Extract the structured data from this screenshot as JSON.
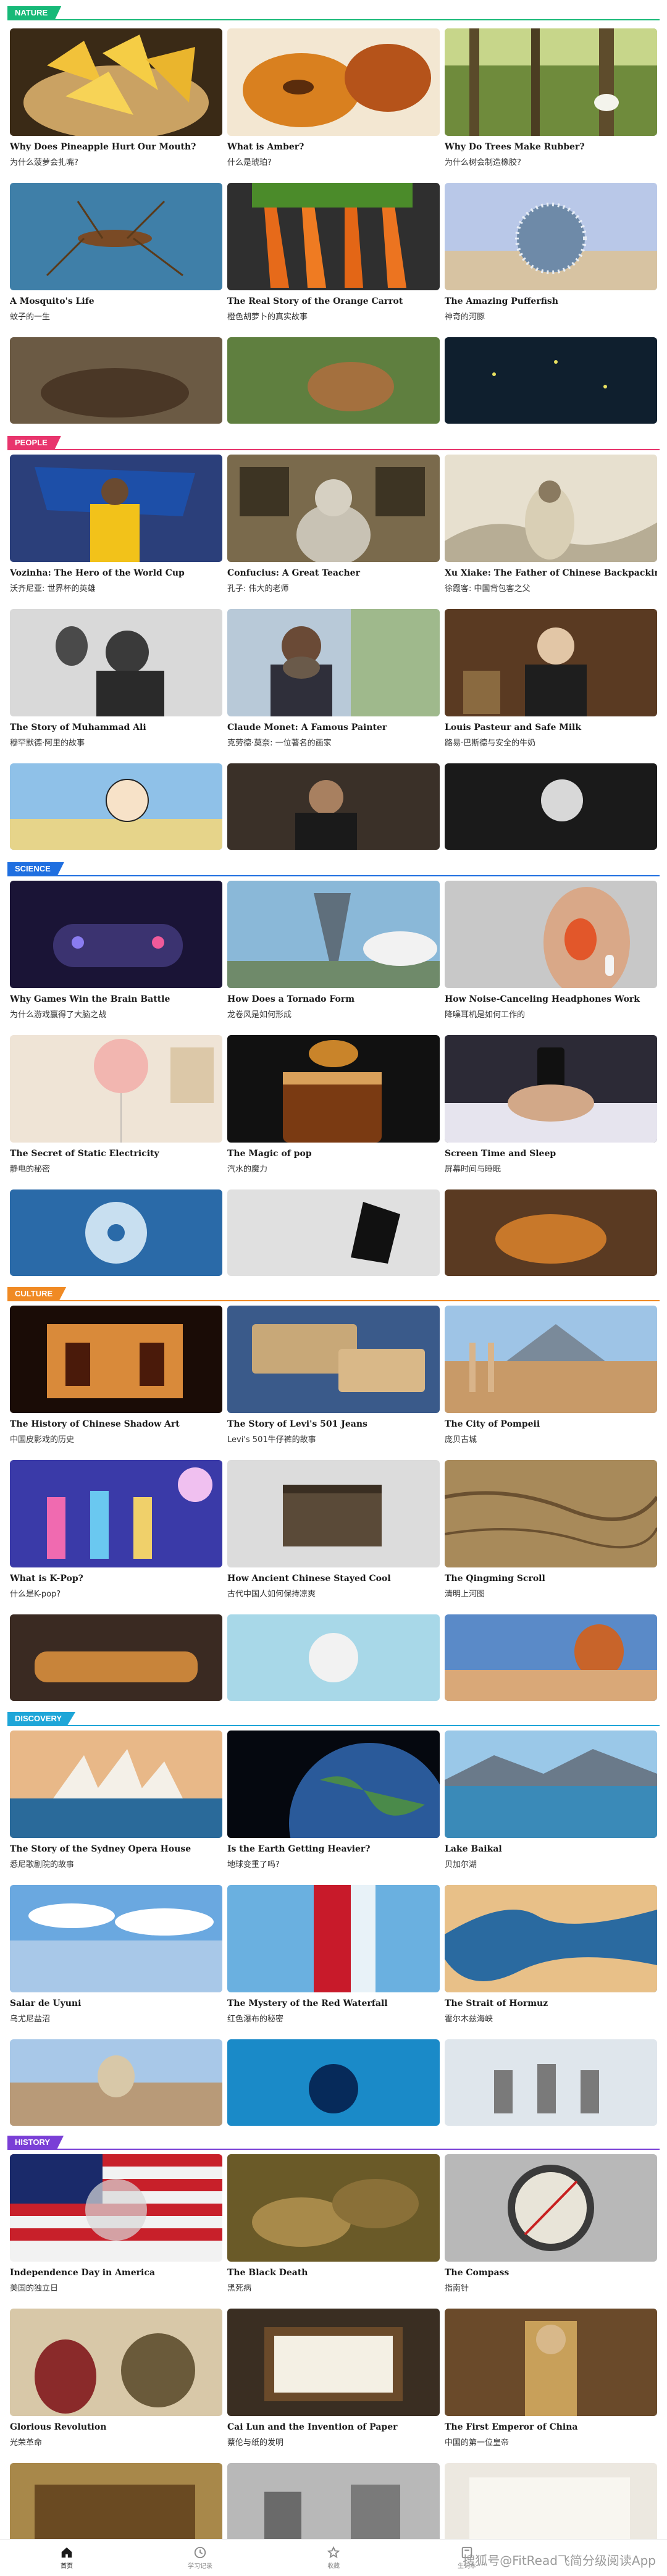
{
  "colors": {
    "nature": "#17b978",
    "people": "#e8356d",
    "science": "#1f6fe0",
    "culture": "#f08a24",
    "discovery": "#1fa6d8",
    "history": "#7a3fd6"
  },
  "sections": {
    "nature": {
      "tag": "NATURE",
      "cards": [
        {
          "en": "Why Does Pineapple Hurt Our Mouth?",
          "zh": "为什么菠萝会扎嘴?"
        },
        {
          "en": "What is Amber?",
          "zh": "什么是琥珀?"
        },
        {
          "en": "Why Do Trees Make Rubber?",
          "zh": "为什么树会制造橡胶?"
        },
        {
          "en": "A Mosquito's Life",
          "zh": "蚊子的一生"
        },
        {
          "en": "The Real Story of the Orange Carrot",
          "zh": "橙色胡萝卜的真实故事"
        },
        {
          "en": "The Amazing Pufferfish",
          "zh": "神奇的河豚"
        }
      ]
    },
    "people": {
      "tag": "PEOPLE",
      "cards": [
        {
          "en": "Vozinha: The Hero of the World Cup",
          "zh": "沃齐尼亚: 世界杯的英雄"
        },
        {
          "en": "Confucius: A Great Teacher",
          "zh": "孔子: 伟大的老师"
        },
        {
          "en": "Xu Xiake: The Father of Chinese Backpacking",
          "zh": "徐霞客: 中国背包客之父"
        },
        {
          "en": "The Story of Muhammad Ali",
          "zh": "穆罕默德·阿里的故事"
        },
        {
          "en": "Claude Monet: A Famous Painter",
          "zh": "克劳德·莫奈: 一位著名的画家"
        },
        {
          "en": "Louis Pasteur and Safe Milk",
          "zh": "路易·巴斯德与安全的牛奶"
        }
      ]
    },
    "science": {
      "tag": "SCIENCE",
      "cards": [
        {
          "en": "Why Games Win the Brain Battle",
          "zh": "为什么游戏赢得了大脑之战"
        },
        {
          "en": "How Does a Tornado Form",
          "zh": "龙卷风是如何形成"
        },
        {
          "en": "How Noise-Canceling Headphones Work",
          "zh": "降噪耳机是如何工作的"
        },
        {
          "en": "The Secret of Static Electricity",
          "zh": "静电的秘密"
        },
        {
          "en": "The Magic of pop",
          "zh": "汽水的魔力"
        },
        {
          "en": "Screen Time and Sleep",
          "zh": "屏幕时间与睡眠"
        }
      ]
    },
    "culture": {
      "tag": "CULTURE",
      "cards": [
        {
          "en": "The History of Chinese Shadow Art",
          "zh": "中国皮影戏的历史"
        },
        {
          "en": "The Story of Levi's 501 Jeans",
          "zh": "Levi's 501牛仔裤的故事"
        },
        {
          "en": "The City of Pompeii",
          "zh": "庞贝古城"
        },
        {
          "en": "What is K-Pop?",
          "zh": "什么是K-pop?"
        },
        {
          "en": "How Ancient Chinese Stayed Cool",
          "zh": "古代中国人如何保持凉爽"
        },
        {
          "en": "The Qingming Scroll",
          "zh": "清明上河图"
        }
      ]
    },
    "discovery": {
      "tag": "DISCOVERY",
      "cards": [
        {
          "en": "The Story of the Sydney Opera House",
          "zh": "悉尼歌剧院的故事"
        },
        {
          "en": "Is the Earth Getting Heavier?",
          "zh": "地球变重了吗?"
        },
        {
          "en": "Lake Baikal",
          "zh": "贝加尔湖"
        },
        {
          "en": "Salar de Uyuni",
          "zh": "乌尤尼盐沼"
        },
        {
          "en": "The Mystery of the Red Waterfall",
          "zh": "红色瀑布的秘密"
        },
        {
          "en": "The Strait of Hormuz",
          "zh": "霍尔木兹海峡"
        }
      ]
    },
    "history": {
      "tag": "HISTORY",
      "cards": [
        {
          "en": "Independence Day in America",
          "zh": "美国的独立日"
        },
        {
          "en": "The Black Death",
          "zh": "黑死病"
        },
        {
          "en": "The Compass",
          "zh": "指南针"
        },
        {
          "en": "Glorious Revolution",
          "zh": "光荣革命"
        },
        {
          "en": "Cai Lun and the Invention of Paper",
          "zh": "蔡伦与纸的发明"
        },
        {
          "en": "The First Emperor of China",
          "zh": "中国的第一位皇帝"
        }
      ]
    }
  },
  "nav": {
    "items": [
      {
        "label": "首页",
        "icon": "home-icon"
      },
      {
        "label": "学习记录",
        "icon": "history-icon"
      },
      {
        "label": "收藏",
        "icon": "star-icon"
      },
      {
        "label": "生词本",
        "icon": "book-icon"
      }
    ],
    "watermark": "搜狐号@FitRead飞简分级阅读App"
  }
}
